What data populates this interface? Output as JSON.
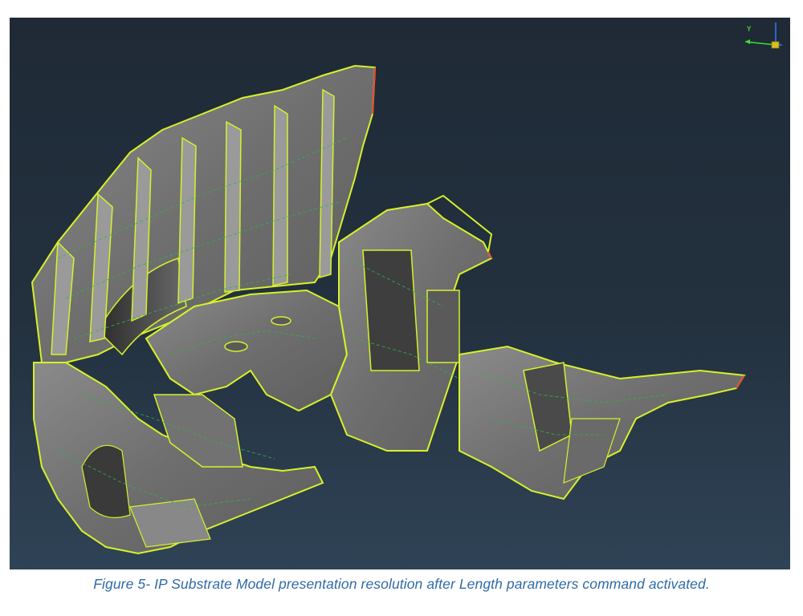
{
  "viewport": {
    "background_top": "#1f2a36",
    "background_bottom": "#2f4356",
    "model_fill": "#7c7c7c",
    "edge_color": "#d6f22a",
    "mesh_color": "#2fb34a"
  },
  "triad": {
    "y_label": "Y",
    "x_axis_color": "#2e7bff",
    "y_axis_color": "#3be22f",
    "z_axis_color": "#d8c020"
  },
  "caption": {
    "text": "Figure 5- IP Substrate Model presentation resolution after Length parameters command activated."
  }
}
